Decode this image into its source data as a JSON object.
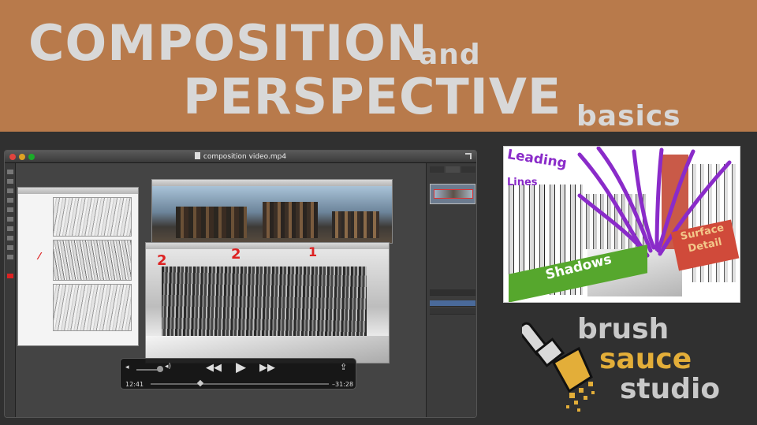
{
  "banner": {
    "line1_big": "COMPOSITION",
    "line1_small": "and",
    "line2_big": "PERSPECTIVE",
    "line2_small": "basics",
    "bg_color": "#b87a4b"
  },
  "video_window": {
    "title": "composition video.mp4",
    "icons": [
      "close-dot",
      "minimize-dot",
      "zoom-dot",
      "file-icon",
      "expand-icon"
    ]
  },
  "player": {
    "elapsed": "12:41",
    "remaining": "–31:28",
    "icons": [
      "volume-low-icon",
      "volume-high-icon",
      "rewind-icon",
      "play-icon",
      "fast-forward-icon",
      "share-icon"
    ]
  },
  "sketch_marks": {
    "mark_a": "2",
    "mark_b": "2",
    "mark_c": "1"
  },
  "thumbnail": {
    "leading": "Leading",
    "lines": "Lines",
    "shadows": "Shadows",
    "surface": "Surface",
    "detail": "Detail",
    "accent_purple": "#8a2bc9",
    "accent_green": "#56a72d",
    "accent_red": "#d04a3a"
  },
  "logo": {
    "word1": "brush",
    "word2": "sauce",
    "word3": "studio",
    "gold": "#e3ae39",
    "grey": "#c9c9c9"
  }
}
